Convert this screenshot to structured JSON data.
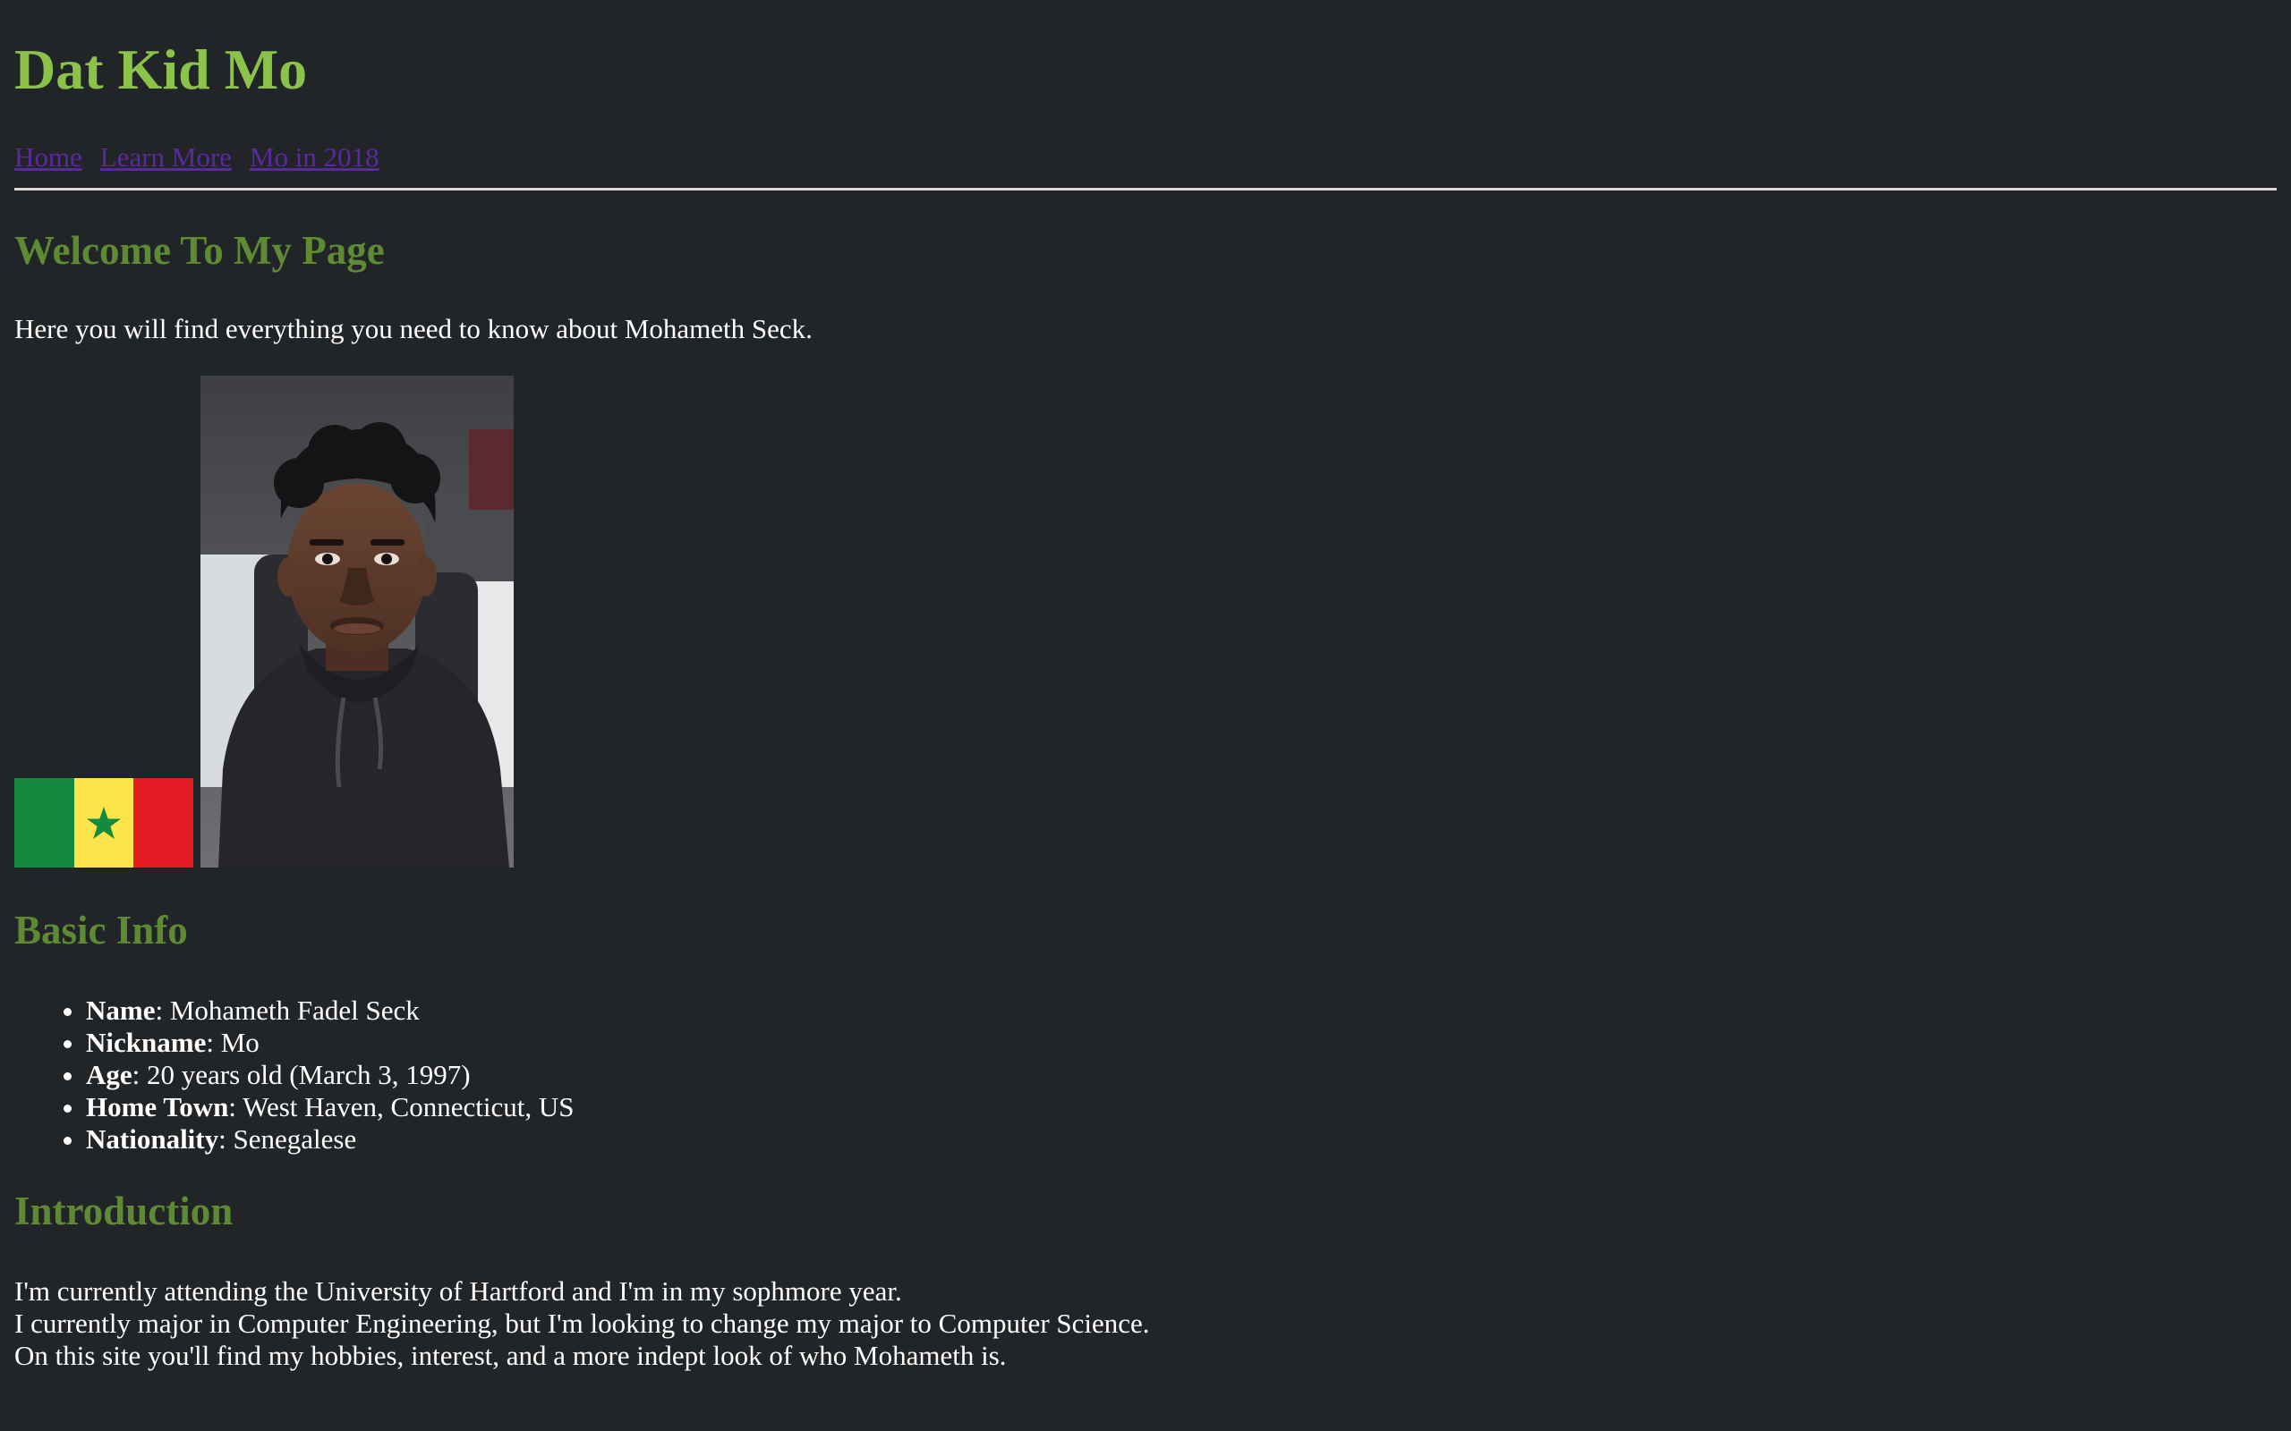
{
  "header": {
    "title": "Dat Kid Mo"
  },
  "nav": {
    "items": [
      {
        "label": "Home"
      },
      {
        "label": "Learn More"
      },
      {
        "label": "Mo in 2018"
      }
    ]
  },
  "welcome": {
    "heading": "Welcome To My Page",
    "text": "Here you will find everything you need to know about Mohameth Seck."
  },
  "images": {
    "flag": "senegal-flag",
    "portrait": "portrait-photo"
  },
  "basic_info": {
    "heading": "Basic Info",
    "items": [
      {
        "label": "Name",
        "value": ": Mohameth Fadel Seck"
      },
      {
        "label": "Nickname",
        "value": ": Mo"
      },
      {
        "label": "Age",
        "value": ": 20 years old (March 3, 1997)"
      },
      {
        "label": "Home Town",
        "value": ": West Haven, Connecticut, US"
      },
      {
        "label": "Nationality",
        "value": ": Senegalese"
      }
    ]
  },
  "introduction": {
    "heading": "Introduction",
    "lines": [
      "I'm currently attending the University of Hartford and I'm in my sophmore year.",
      "I currently major in Computer Engineering, but I'm looking to change my major to Computer Science.",
      "On this site you'll find my hobbies, interest, and a more indept look of who Mohameth is."
    ]
  },
  "colors": {
    "background": "#212528",
    "title": "#8bc34a",
    "heading": "#5e8a34",
    "link": "#5b2a9a",
    "text": "#ffffff"
  }
}
